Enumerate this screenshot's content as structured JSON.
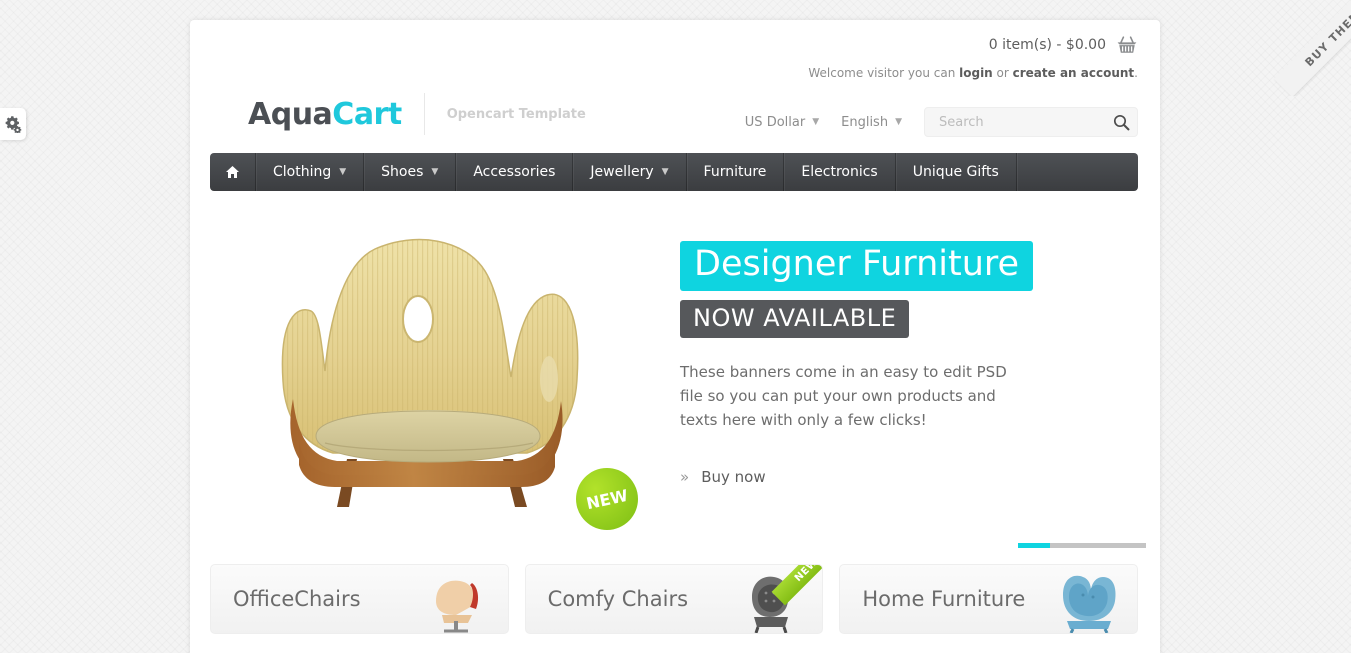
{
  "corner_ribbon": {
    "label": "BUY THEME"
  },
  "settings_tab": {
    "icon": "gear-icon"
  },
  "header": {
    "cart": {
      "text": "0 item(s) - $0.00",
      "icon": "basket-icon"
    },
    "welcome": {
      "prefix": "Welcome visitor you can ",
      "login": "login",
      "middle": " or ",
      "register": "create an account",
      "suffix": "."
    },
    "logo": {
      "part1": "Aqua",
      "part2": "Cart"
    },
    "tagline": "Opencart Template",
    "currency": {
      "label": "US Dollar",
      "icon": "chevron-down-icon"
    },
    "language": {
      "label": "English",
      "icon": "chevron-down-icon"
    },
    "search": {
      "value": "",
      "placeholder": "Search",
      "icon": "search-icon"
    }
  },
  "nav": {
    "items": [
      {
        "label": "",
        "icon": "home-icon",
        "caret": false
      },
      {
        "label": "Clothing",
        "caret": true
      },
      {
        "label": "Shoes",
        "caret": true
      },
      {
        "label": "Accessories",
        "caret": false
      },
      {
        "label": "Jewellery",
        "caret": true
      },
      {
        "label": "Furniture",
        "caret": false
      },
      {
        "label": "Electronics",
        "caret": false
      },
      {
        "label": "Unique Gifts",
        "caret": false
      }
    ]
  },
  "slider": {
    "headline": "Designer Furniture",
    "subhead": "NOW AVAILABLE",
    "body": "These banners come in an easy to edit PSD file so you can put your own products and texts here with only a few clicks!",
    "cta": {
      "label": "Buy now",
      "icon": "double-chevron-right-icon"
    },
    "badge": "NEW",
    "pages": 4,
    "active_page": 1
  },
  "cards": [
    {
      "title": "OfficeChairs",
      "ribbon": ""
    },
    {
      "title": "Comfy Chairs",
      "ribbon": "NEW"
    },
    {
      "title": "Home Furniture",
      "ribbon": ""
    }
  ],
  "colors": {
    "accent_cyan": "#0fd4e0",
    "logo_cyan": "#1fc8dc",
    "nav_dark": "#46494d",
    "badge_green": "#8dc91b",
    "subhead_gray": "#56585b"
  }
}
